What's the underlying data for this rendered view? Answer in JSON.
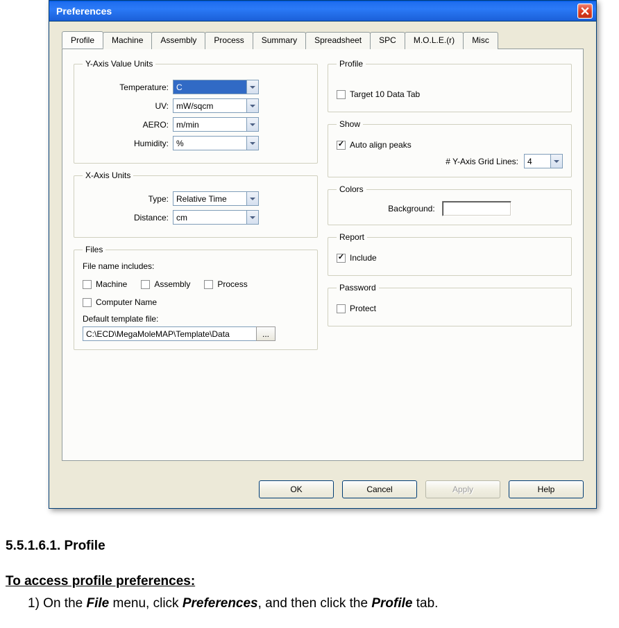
{
  "window": {
    "title": "Preferences"
  },
  "tabs": [
    "Profile",
    "Machine",
    "Assembly",
    "Process",
    "Summary",
    "Spreadsheet",
    "SPC",
    "M.O.L.E.(r)",
    "Misc"
  ],
  "active_tab": 0,
  "yaxis": {
    "legend": "Y-Axis Value Units",
    "temperature_label": "Temperature:",
    "temperature_value": "C",
    "uv_label": "UV:",
    "uv_value": "mW/sqcm",
    "aero_label": "AERO:",
    "aero_value": "m/min",
    "humidity_label": "Humidity:",
    "humidity_value": "%"
  },
  "xaxis": {
    "legend": "X-Axis Units",
    "type_label": "Type:",
    "type_value": "Relative Time",
    "distance_label": "Distance:",
    "distance_value": "cm"
  },
  "files": {
    "legend": "Files",
    "includes_label": "File name includes:",
    "machine": "Machine",
    "assembly": "Assembly",
    "process": "Process",
    "computer_name": "Computer Name",
    "template_label": "Default template file:",
    "template_path": "C:\\ECD\\MegaMoleMAP\\Template\\Data",
    "browse": "..."
  },
  "profile_group": {
    "legend": "Profile",
    "target10": "Target 10 Data Tab"
  },
  "show": {
    "legend": "Show",
    "auto_align": "Auto align peaks",
    "grid_lines_label": "# Y-Axis Grid Lines:",
    "grid_lines_value": "4"
  },
  "colors": {
    "legend": "Colors",
    "background_label": "Background:",
    "background_color": "#ffffff"
  },
  "report": {
    "legend": "Report",
    "include": "Include"
  },
  "password": {
    "legend": "Password",
    "protect": "Protect"
  },
  "buttons": {
    "ok": "OK",
    "cancel": "Cancel",
    "apply": "Apply",
    "help": "Help"
  },
  "document": {
    "section": "5.5.1.6.1. Profile",
    "heading": "To access profile preferences:",
    "step1_prefix": "1) On the ",
    "step1_file": "File",
    "step1_mid": " menu, click ",
    "step1_prefs": "Preferences",
    "step1_mid2": ", and then click the ",
    "step1_profile": "Profile",
    "step1_end": " tab."
  }
}
